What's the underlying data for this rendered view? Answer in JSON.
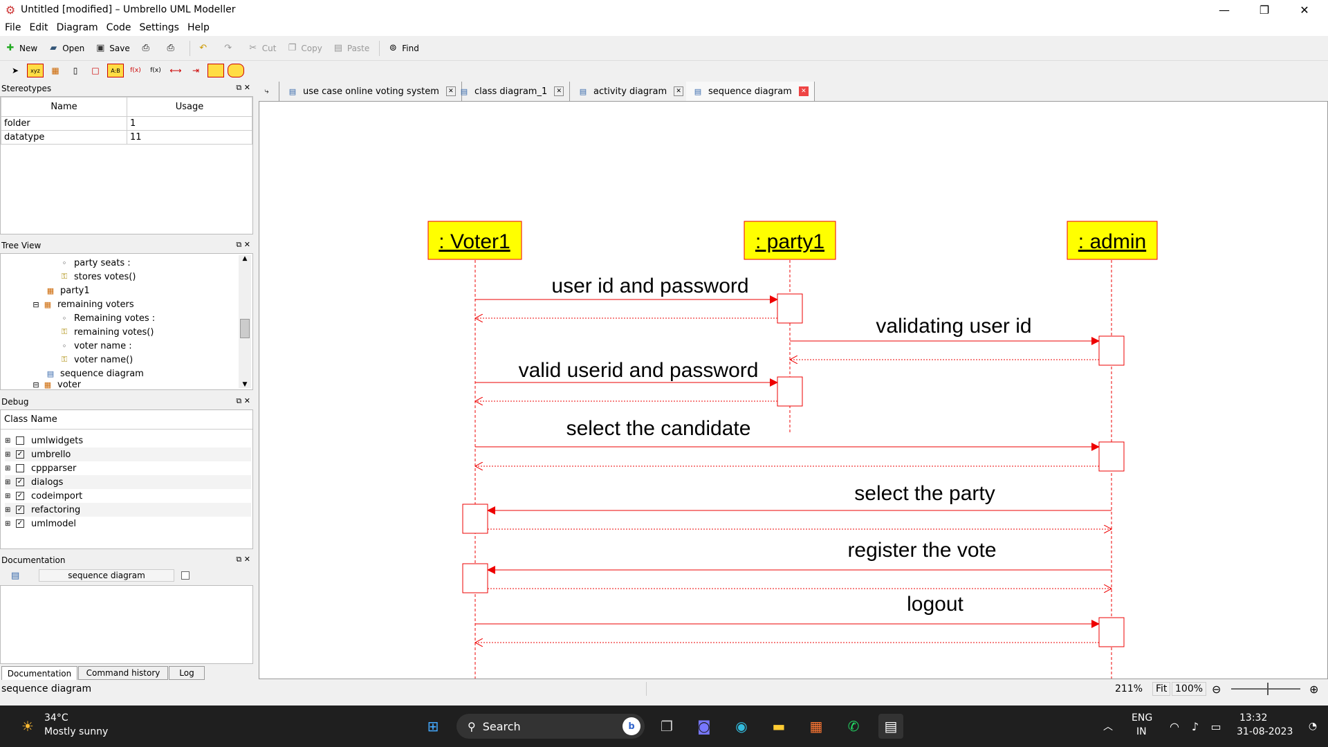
{
  "window": {
    "title": "Untitled [modified] – Umbrello UML Modeller"
  },
  "menu": [
    "File",
    "Edit",
    "Diagram",
    "Code",
    "Settings",
    "Help"
  ],
  "toolbar": {
    "new": "New",
    "open": "Open",
    "save": "Save",
    "cut": "Cut",
    "copy": "Copy",
    "paste": "Paste",
    "find": "Find"
  },
  "stereotypes": {
    "title": "Stereotypes",
    "col_name": "Name",
    "col_usage": "Usage",
    "rows": [
      {
        "name": "folder",
        "usage": "1"
      },
      {
        "name": "datatype",
        "usage": "11"
      }
    ]
  },
  "treeview": {
    "title": "Tree View",
    "items": [
      "party seats :",
      "stores votes()",
      "party1",
      "remaining voters",
      "Remaining votes :",
      "remaining votes()",
      "voter name :",
      "voter name()",
      "sequence diagram",
      "voter"
    ]
  },
  "debug": {
    "title": "Debug",
    "col": "Class Name",
    "rows": [
      {
        "name": "umlwidgets",
        "checked": false
      },
      {
        "name": "umbrello",
        "checked": true
      },
      {
        "name": "cppparser",
        "checked": false
      },
      {
        "name": "dialogs",
        "checked": true
      },
      {
        "name": "codeimport",
        "checked": true
      },
      {
        "name": "refactoring",
        "checked": true
      },
      {
        "name": "umlmodel",
        "checked": true
      }
    ]
  },
  "documentation": {
    "title": "Documentation",
    "field": "sequence diagram",
    "tabs": [
      "Documentation",
      "Command history",
      "Log"
    ]
  },
  "tabs": [
    "use case online voting system",
    "class diagram_1",
    "activity diagram",
    "sequence diagram"
  ],
  "diagram": {
    "objects": [
      ": Voter1",
      ": party1",
      ": admin"
    ],
    "messages": [
      "user id and password",
      "validating user id",
      "valid userid and password",
      "select the candidate",
      "select the party",
      "register the vote",
      "logout"
    ]
  },
  "status": {
    "text": "sequence diagram",
    "zoom": "211%",
    "fit": "Fit",
    "hundred": "100%"
  },
  "taskbar": {
    "temp": "34°C",
    "weather": "Mostly sunny",
    "search": "Search",
    "lang1": "ENG",
    "lang2": "IN",
    "time": "13:32",
    "date": "31-08-2023"
  }
}
